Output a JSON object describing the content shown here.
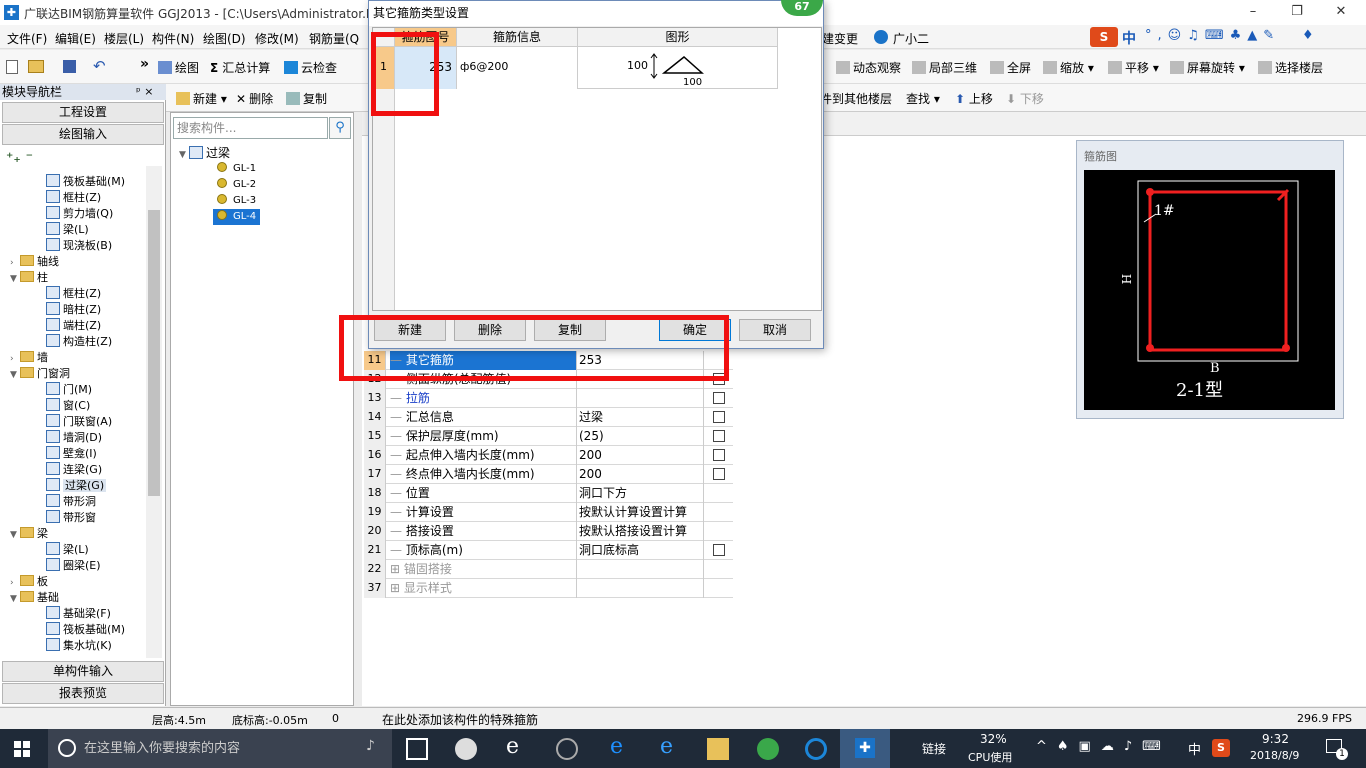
{
  "window": {
    "title": "广联达BIM钢筋算量软件 GGJ2013 - [C:\\Users\\Administrator.P",
    "controls": [
      "–",
      "❐",
      "✕"
    ]
  },
  "menu": {
    "items": [
      "文件(F)",
      "编辑(E)",
      "楼层(L)",
      "构件(N)",
      "绘图(D)",
      "修改(M)",
      "钢筋量(Q"
    ],
    "right_items": [
      "建变更",
      "广小二"
    ]
  },
  "ime": {
    "label": "中"
  },
  "toolbar1": {
    "draw": "绘图",
    "sum": "汇总计算",
    "cloud": "云检查",
    "dynamic_view": "动态观察",
    "local_3d": "局部三维",
    "fullscreen": "全屏",
    "zoom": "缩放",
    "pan": "平移",
    "rotate": "屏幕旋转",
    "select_floor": "选择楼层"
  },
  "toolbar2": {
    "new": "新建",
    "delete": "删除",
    "copy": "复制",
    "to_other_floor": "件到其他楼层",
    "find": "查找",
    "move_up": "上移",
    "move_down": "下移"
  },
  "nav": {
    "title": "模块导航栏",
    "pin": "ᵖ ×",
    "project_settings": "工程设置",
    "draw_input": "绘图输入",
    "single_input": "单构件输入",
    "report_preview": "报表预览",
    "tree": [
      {
        "label": "筏板基础(M)",
        "level": 2
      },
      {
        "label": "框柱(Z)",
        "level": 2
      },
      {
        "label": "剪力墙(Q)",
        "level": 2
      },
      {
        "label": "梁(L)",
        "level": 2
      },
      {
        "label": "现浇板(B)",
        "level": 2
      },
      {
        "label": "轴线",
        "level": 1,
        "collapsed": true
      },
      {
        "label": "柱",
        "level": 1
      },
      {
        "label": "框柱(Z)",
        "level": 2
      },
      {
        "label": "暗柱(Z)",
        "level": 2
      },
      {
        "label": "端柱(Z)",
        "level": 2
      },
      {
        "label": "构造柱(Z)",
        "level": 2
      },
      {
        "label": "墙",
        "level": 1,
        "collapsed": true
      },
      {
        "label": "门窗洞",
        "level": 1
      },
      {
        "label": "门(M)",
        "level": 2
      },
      {
        "label": "窗(C)",
        "level": 2
      },
      {
        "label": "门联窗(A)",
        "level": 2
      },
      {
        "label": "墙洞(D)",
        "level": 2
      },
      {
        "label": "壁龛(I)",
        "level": 2
      },
      {
        "label": "连梁(G)",
        "level": 2
      },
      {
        "label": "过梁(G)",
        "level": 2,
        "selected": true
      },
      {
        "label": "带形洞",
        "level": 2
      },
      {
        "label": "带形窗",
        "level": 2
      },
      {
        "label": "梁",
        "level": 1
      },
      {
        "label": "梁(L)",
        "level": 2
      },
      {
        "label": "圈梁(E)",
        "level": 2
      },
      {
        "label": "板",
        "level": 1,
        "collapsed": true
      },
      {
        "label": "基础",
        "level": 1
      },
      {
        "label": "基础梁(F)",
        "level": 2
      },
      {
        "label": "筏板基础(M)",
        "level": 2
      },
      {
        "label": "集水坑(K)",
        "level": 2
      }
    ]
  },
  "components": {
    "search_placeholder": "搜索构件...",
    "root": "过梁",
    "items": [
      "GL-1",
      "GL-2",
      "GL-3",
      "GL-4"
    ],
    "selected": "GL-4"
  },
  "dialog": {
    "title": "其它箍筋类型设置",
    "badge": "67",
    "columns": [
      "箍筋图号",
      "箍筋信息",
      "图形"
    ],
    "row": {
      "index": "1",
      "code": "253",
      "info": "ф6@200",
      "dim_left": "100",
      "dim_bottom": "100"
    },
    "buttons": {
      "new": "新建",
      "delete": "删除",
      "copy": "复制",
      "ok": "确定",
      "cancel": "取消"
    }
  },
  "properties": [
    {
      "n": "11",
      "name": "其它箍筋",
      "value": "253",
      "selected": true,
      "check": false
    },
    {
      "n": "12",
      "name": "侧面纵筋(总配筋值)",
      "value": "",
      "check": true
    },
    {
      "n": "13",
      "name": "拉筋",
      "value": "",
      "check": true,
      "blue": true
    },
    {
      "n": "14",
      "name": "汇总信息",
      "value": "过梁",
      "check": true
    },
    {
      "n": "15",
      "name": "保护层厚度(mm)",
      "value": "(25)",
      "check": true
    },
    {
      "n": "16",
      "name": "起点伸入墙内长度(mm)",
      "value": "200",
      "check": true
    },
    {
      "n": "17",
      "name": "终点伸入墙内长度(mm)",
      "value": "200",
      "check": true
    },
    {
      "n": "18",
      "name": "位置",
      "value": "洞口下方",
      "check": false
    },
    {
      "n": "19",
      "name": "计算设置",
      "value": "按默认计算设置计算",
      "check": false
    },
    {
      "n": "20",
      "name": "搭接设置",
      "value": "按默认搭接设置计算",
      "check": false
    },
    {
      "n": "21",
      "name": "顶标高(m)",
      "value": "洞口底标高",
      "check": true
    },
    {
      "n": "22",
      "name": "锚固搭接",
      "value": "",
      "expand": true,
      "grey": true
    },
    {
      "n": "37",
      "name": "显示样式",
      "value": "",
      "expand": true,
      "grey": true
    }
  ],
  "preview": {
    "title": "箍筋图",
    "label_1": "1#",
    "label_h": "H",
    "label_b": "B",
    "type": "2-1型"
  },
  "status": {
    "floor_height": "层高:4.5m",
    "bottom_elev": "底标高:-0.05m",
    "zero": "0",
    "hint": "在此处添加该构件的特殊箍筋",
    "fps": "296.9 FPS"
  },
  "taskbar": {
    "search_placeholder": "在这里输入你要搜索的内容",
    "link": "链接",
    "cpu_percent": "32%",
    "cpu_label": "CPU使用",
    "lang": "中",
    "time": "9:32",
    "date": "2018/8/9",
    "notif": "1"
  },
  "colors": {
    "highlight_red": "#f01010",
    "selection_blue": "#1b74d2",
    "taskbar_bg": "#1f2a38"
  }
}
